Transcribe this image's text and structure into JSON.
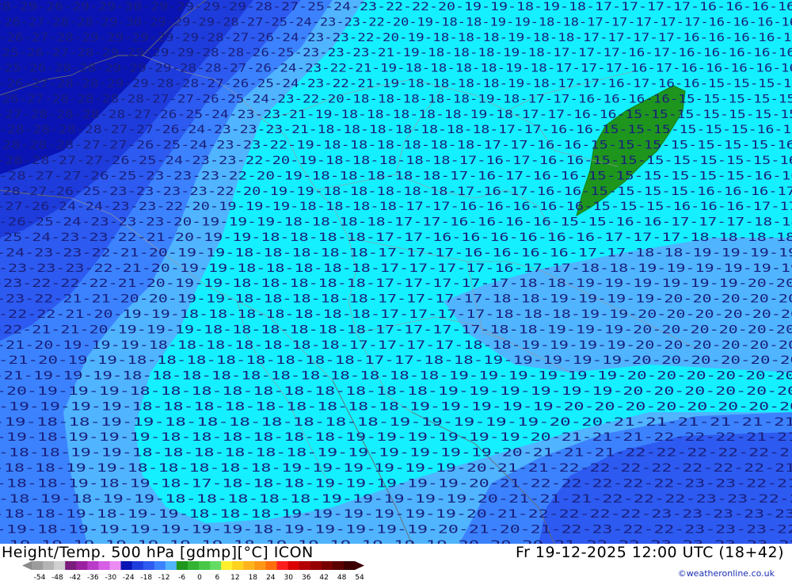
{
  "product": {
    "left_title": "Height/Temp. 500 hPa [gdmp][°C] ICON",
    "right_title": "Fr 19-12-2025 12:00 UTC (18+42)",
    "copyright": "©weatheronline.co.uk"
  },
  "scale": {
    "ticks": [
      "-54",
      "-48",
      "-42",
      "-36",
      "-30",
      "-24",
      "-18",
      "-12",
      "-6",
      "0",
      "6",
      "12",
      "18",
      "24",
      "30",
      "36",
      "42",
      "48",
      "54"
    ],
    "colors": [
      "#9c9c9c",
      "#b4b4b4",
      "#d0d0d0",
      "#7a1c7c",
      "#9a22a0",
      "#b83cc8",
      "#d65fe6",
      "#ea8cf2",
      "#0a14b4",
      "#1e3cdc",
      "#2d5af0",
      "#3c82ff",
      "#50b4ff",
      "#1e961e",
      "#32b432",
      "#46c846",
      "#64dc64",
      "#fff02d",
      "#ffd21e",
      "#ffb41e",
      "#ff9614",
      "#ff6e0a",
      "#ff1e1e",
      "#dc0000",
      "#b40000",
      "#960000",
      "#780000",
      "#5a0000",
      "#3c0000"
    ]
  },
  "map": {
    "field_colors": {
      "le_27": "#0a14b4",
      "m23_27": "#1e3cdc",
      "m21_23": "#2d5af0",
      "m19_21": "#3c82ff",
      "m17_19": "#50b4ff",
      "gt_m17": "#14f0ff",
      "le_m15": "#1e961e"
    },
    "contour_label_color": "#1a1f7a",
    "label_rows": [
      "28-29-26-29-29-30-29-29-29-29-28-27-25-24-23-22-22-20-19-19-18-19-18-17-17-17-17-16-16-16-16",
      "-26-27-28-28-29-30-29-29-29-28-27-25-24-23-23-22-20-19-18-18-19-19-18-18-17-17-17-17-17-16-16-16-16",
      "-26-27-28-29-29-29-29-29-28-27-26-24-23-23-22-20-19-18-18-18-19-18-18-17-17-17-17-16-16-16-16-16",
      "-25-26-27-28-29-29-29-29-28-28-26-25-23-23-23-21-19-18-18-18-19-18-17-17-17-16-17-16-16-16-16-16",
      "-25-26-28-28-29-29-29-28-28-27-26-24-23-22-21-19-18-18-18-18-19-18-17-17-17-16-17-16-16-16-16-16",
      "-26-27-28-28-29-29-28-28-27-26-25-24-23-22-21-19-18-18-18-18-19-18-17-17-16-17-16-16-15-15-15-15",
      "-26-27-28-28-28-28-27-27-26-25-24-23-22-20-18-18-18-18-18-19-18-17-17-16-16-16-16-15-15-15-15-15",
      "-27-28-28-28-28-27-26-25-24-23-23-21-19-18-18-18-18-18-19-18-17-17-16-16-15-15-15-15-15-15-15",
      "-28-28-28-28-27-27-26-24-23-23-23-21-18-18-18-18-18-18-18-17-17-16-16-15-15-15-15-15-15-16-16",
      "-28-28-28-27-27-26-25-24-23-23-22-19-18-18-18-18-18-18-17-17-16-16-15-15-15-15-15-15-15-16",
      "-28-28-27-27-26-25-24-23-23-22-20-19-18-18-18-18-18-17-16-17-16-16-15-15-15-15-15-15-15-16",
      "-28-27-27-26-25-23-23-23-22-20-19-18-18-18-18-18-17-16-17-16-16-15-15-15-15-15-15-16-16",
      "-28-27-26-25-23-23-23-23-22-20-19-19-18-18-18-18-18-17-16-17-16-16-15-15-15-15-16-16-16-17",
      "-27-26-24-24-23-23-22-20-19-19-19-18-18-18-18-17-17-16-16-16-16-16-15-15-15-16-16-16-17-17",
      "-26-25-24-23-23-23-20-19-19-19-18-18-18-18-17-17-16-16-16-16-15-15-16-16-17-17-17-18-18",
      "-25-24-23-23-22-21-20-19-19-18-18-18-18-17-17-16-16-16-16-16-16-17-17-17-18-18-18-18",
      "-24-23-23-22-21-20-19-19-18-18-18-18-18-17-17-17-16-16-16-16-17-17-18-18-19-19-19-19",
      "-23-23-23-22-21-20-19-19-18-18-18-18-18-17-17-17-17-16-17-17-18-18-19-19-19-19-19-19",
      "-23-22-22-22-21-20-19-19-18-18-18-18-18-17-17-17-17-17-18-18-19-19-19-19-19-19-20-20",
      "-23-22-21-21-20-20-19-19-18-18-18-18-18-17-17-17-17-18-18-19-19-19-19-20-20-20-20-20",
      "-22-22-21-20-19-19-18-18-18-18-18-18-18-17-17-17-17-18-18-18-19-19-20-20-20-20-20-20",
      "-22-21-21-20-19-19-19-18-18-18-18-18-18-17-17-17-17-18-18-19-19-19-20-20-20-20-20-20",
      "-21-20-19-19-19-18-18-18-18-18-18-18-17-17-17-17-18-18-19-19-19-19-20-20-20-20-20-20",
      "-21-20-19-19-18-18-18-18-18-18-18-18-17-17-18-18-19-19-19-19-19-20-20-20-20-20-20",
      "-21-19-19-19-18-18-18-18-18-18-18-18-18-18-18-19-19-19-19-19-19-20-20-20-20-20-20",
      "-20-19-19-19-18-18-18-18-18-18-18-18-18-18-19-19-19-19-19-19-20-20-20-20-20-20",
      "-19-19-19-19-18-18-18-18-18-18-18-18-18-19-19-19-19-19-20-20-20-20-20-20-20-20",
      "-19-18-18-19-19-18-18-18-18-18-18-18-19-19-19-19-19-20-20-21-21-21-21-21-21",
      "-19-18-19-19-19-18-18-18-18-18-18-19-19-19-19-19-19-20-21-21-21-22-22-22-21-21",
      "-18-18-19-19-18-18-18-18-18-18-19-19-19-19-19-19-20-21-21-21-22-22-22-22-22-21",
      "-18-18-19-19-18-18-18-18-18-19-19-19-19-19-19-20-21-21-22-22-22-22-22-22-22-21",
      "-18-18-19-18-19-18-17-18-18-18-19-19-19-19-19-20-21-22-22-22-22-22-23-23-22-21",
      "-18-19-18-19-19-18-18-18-18-18-19-19-19-19-19-20-21-21-21-22-22-22-23-23-22-2",
      "-18-18-19-18-19-19-18-18-18-19-19-19-19-19-19-20-21-22-22-22-22-23-23-23-23-23",
      "-19-18-19-19-19-19-19-19-18-19-19-19-19-19-20-21-20-21-22-23-22-22-23-23-23-22",
      "-19-19-19-19-19-19-19-18-19-19-19-19-19-19-20-20-20-21-22-22-23-23-23-23-22"
    ]
  }
}
